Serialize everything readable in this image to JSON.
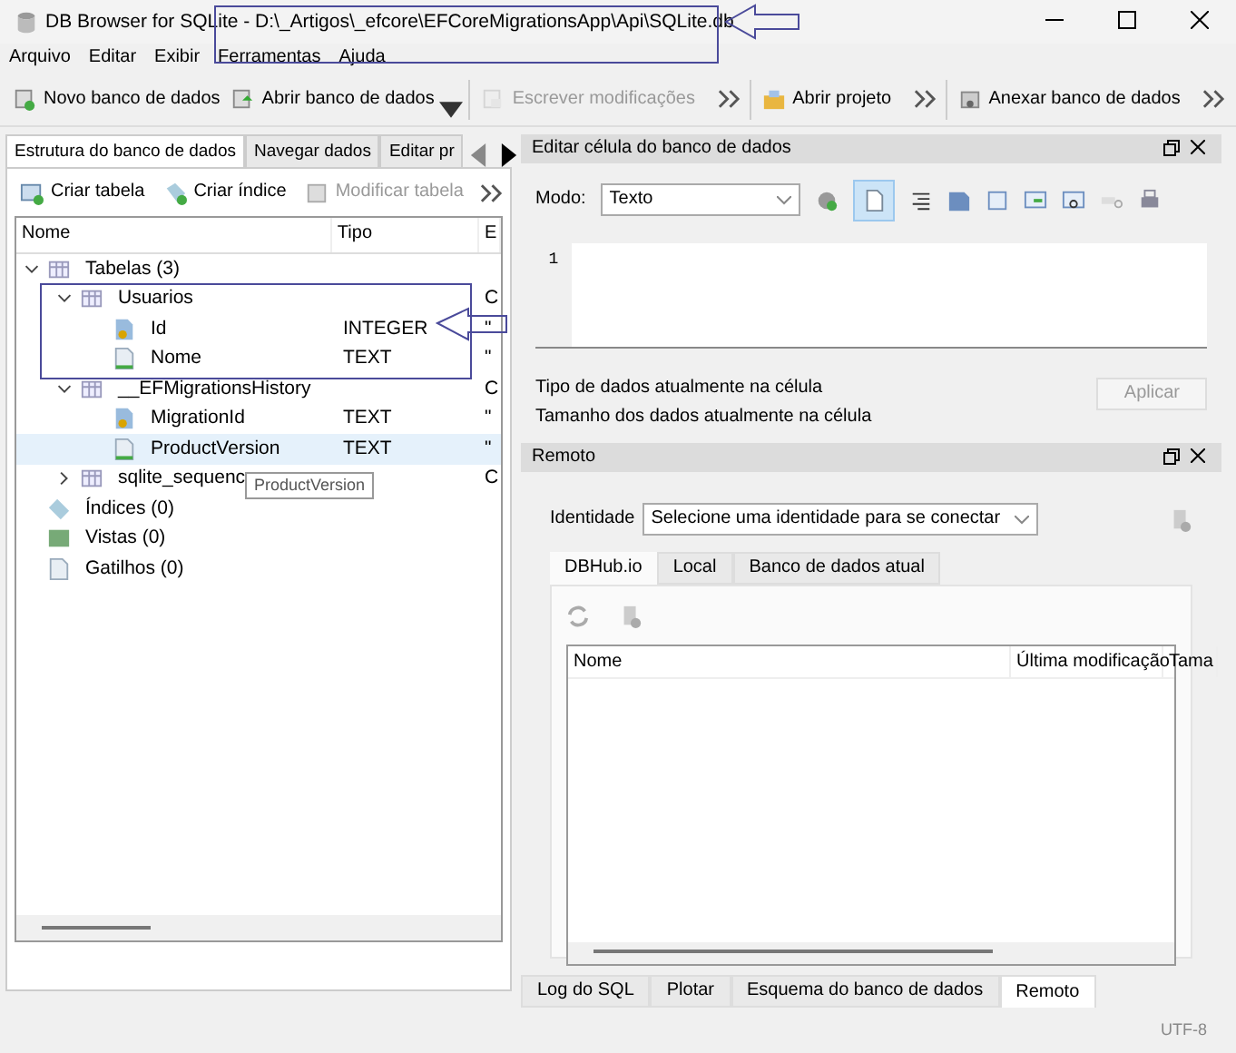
{
  "window": {
    "title": "DB Browser for SQLite - D:\\_Artigos\\_efcore\\EFCoreMigrationsApp\\Api\\SQLite.db"
  },
  "menu": [
    "Arquivo",
    "Editar",
    "Exibir",
    "Ferramentas",
    "Ajuda"
  ],
  "toolbar": [
    {
      "label": "Novo banco de dados",
      "kind": "new",
      "disabled": false
    },
    {
      "label": "Abrir banco de dados",
      "kind": "open",
      "disabled": false
    },
    {
      "label": "Escrever modificações",
      "kind": "write",
      "disabled": true
    },
    {
      "label": "Abrir projeto",
      "kind": "project",
      "disabled": false
    },
    {
      "label": "Anexar banco de dados",
      "kind": "attach",
      "disabled": false
    }
  ],
  "left_tabs": [
    {
      "label": "Estrutura do banco de dados",
      "selected": true
    },
    {
      "label": "Navegar dados",
      "selected": false
    },
    {
      "label": "Editar pr",
      "selected": false
    }
  ],
  "left_actions": [
    {
      "label": "Criar tabela",
      "disabled": false
    },
    {
      "label": "Criar índice",
      "disabled": false
    },
    {
      "label": "Modificar tabela",
      "disabled": true
    }
  ],
  "tree": {
    "columns": [
      "Nome",
      "Tipo",
      "E"
    ],
    "items": [
      {
        "name": "Tabelas (3)",
        "kind": "table",
        "expanded": true,
        "children": [
          {
            "name": "Usuarios",
            "kind": "table",
            "column_3": "C",
            "expanded": true,
            "children": [
              {
                "name": "Id",
                "kind": "key",
                "type": "INTEGER",
                "column_3": "\""
              },
              {
                "name": "Nome",
                "kind": "field",
                "type": "TEXT",
                "column_3": "\""
              }
            ]
          },
          {
            "name": "__EFMigrationsHistory",
            "kind": "table",
            "column_3": "C",
            "expanded": true,
            "children": [
              {
                "name": "MigrationId",
                "kind": "key",
                "type": "TEXT",
                "column_3": "\""
              },
              {
                "name": "ProductVersion",
                "kind": "field",
                "type": "TEXT",
                "column_3": "\"",
                "hovered": true
              }
            ]
          },
          {
            "name": "sqlite_sequenc",
            "kind": "table",
            "column_3": "C",
            "expanded": false
          }
        ]
      },
      {
        "name": "Índices (0)",
        "kind": "index"
      },
      {
        "name": "Vistas (0)",
        "kind": "view"
      },
      {
        "name": "Gatilhos (0)",
        "kind": "trigger"
      }
    ]
  },
  "tooltip": "ProductVersion",
  "edit_cell": {
    "title": "Editar célula do banco de dados",
    "mode_label": "Modo:",
    "mode_value": "Texto",
    "line_number": "1",
    "type_label": "Tipo de dados atualmente na célula",
    "size_label": "Tamanho dos dados atualmente na célula",
    "apply": {
      "label": "Aplicar",
      "disabled": true
    }
  },
  "remote": {
    "title": "Remoto",
    "identity_label": "Identidade",
    "identity_value": "Selecione uma identidade para se conectar",
    "tabs": [
      {
        "label": "DBHub.io",
        "selected": true
      },
      {
        "label": "Local",
        "selected": false
      },
      {
        "label": "Banco de dados atual",
        "selected": false
      }
    ],
    "columns": [
      "Nome",
      "Última modificação",
      "Tama"
    ]
  },
  "bottom_tabs": [
    {
      "label": "Log do SQL",
      "selected": false
    },
    {
      "label": "Plotar",
      "selected": false
    },
    {
      "label": "Esquema do banco de dados",
      "selected": false
    },
    {
      "label": "Remoto",
      "selected": true
    }
  ],
  "status_bar": "UTF-8"
}
